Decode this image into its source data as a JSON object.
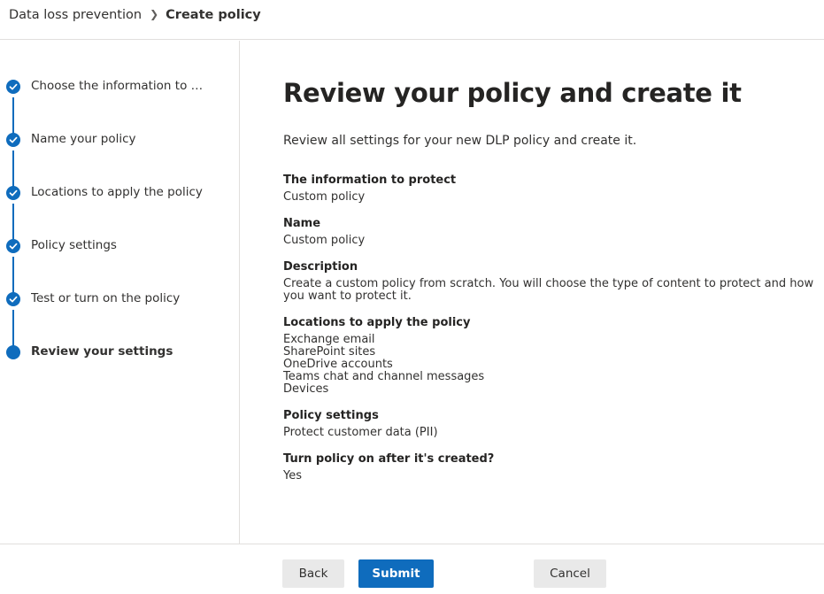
{
  "breadcrumb": {
    "parent": "Data loss prevention",
    "current": "Create policy"
  },
  "steps": [
    {
      "label": "Choose the information to p..."
    },
    {
      "label": "Name your policy"
    },
    {
      "label": "Locations to apply the policy"
    },
    {
      "label": "Policy settings"
    },
    {
      "label": "Test or turn on the policy"
    },
    {
      "label": "Review your settings"
    }
  ],
  "main": {
    "title": "Review your policy and create it",
    "subtitle": "Review all settings for your new DLP policy and create it.",
    "sections": {
      "info": {
        "heading": "The information to protect",
        "value": "Custom policy"
      },
      "name": {
        "heading": "Name",
        "value": "Custom policy"
      },
      "description": {
        "heading": "Description",
        "value": "Create a custom policy from scratch. You will choose the type of content to protect and how you want to protect it."
      },
      "locations": {
        "heading": "Locations to apply the policy",
        "items": [
          "Exchange email",
          "SharePoint sites",
          "OneDrive accounts",
          "Teams chat and channel messages",
          "Devices"
        ]
      },
      "settings": {
        "heading": "Policy settings",
        "value": "Protect customer data (PII)"
      },
      "turnon": {
        "heading": "Turn policy on after it's created?",
        "value": "Yes"
      }
    }
  },
  "footer": {
    "back": "Back",
    "submit": "Submit",
    "cancel": "Cancel"
  },
  "colors": {
    "accent": "#0f6cbd",
    "border": "#e1dfdd",
    "secondary_button": "#e9e9e9"
  }
}
